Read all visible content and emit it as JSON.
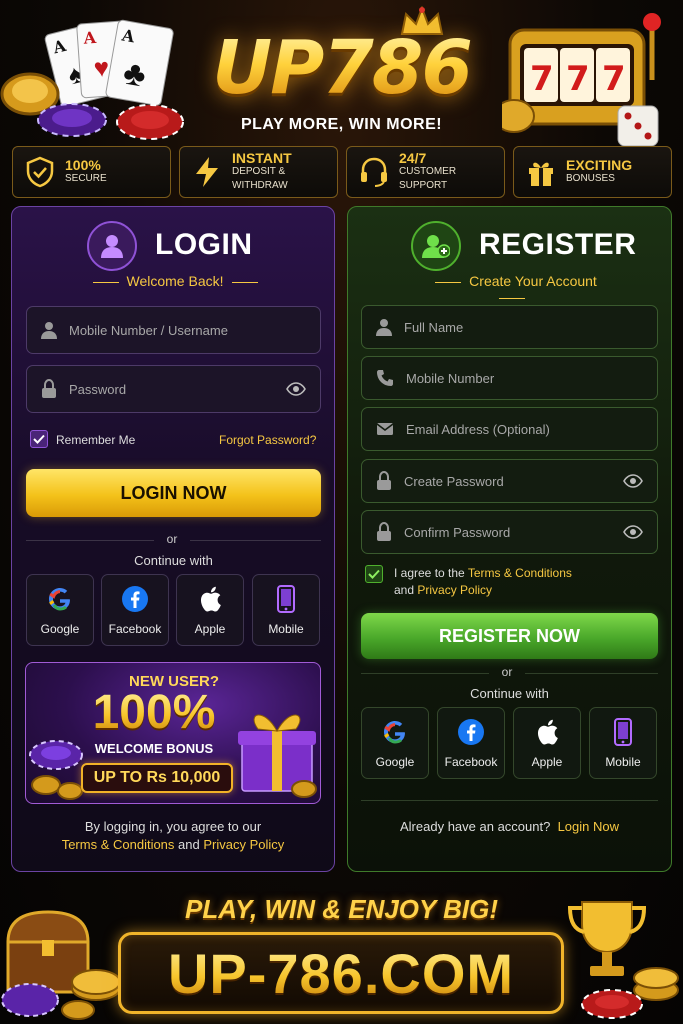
{
  "brand": {
    "logo": "UP786",
    "tagline": "PLAY MORE, WIN MORE!",
    "gold": "#f6c842"
  },
  "features": [
    {
      "icon": "shield-check-icon",
      "title": "100%",
      "subtitle": "SECURE"
    },
    {
      "icon": "lightning-icon",
      "title": "INSTANT",
      "subtitle": "DEPOSIT & WITHDRAW"
    },
    {
      "icon": "headset-icon",
      "title": "24/7",
      "subtitle": "CUSTOMER SUPPORT"
    },
    {
      "icon": "gift-icon",
      "title": "EXCITING",
      "subtitle": "BONUSES"
    }
  ],
  "login": {
    "title": "LOGIN",
    "subtitle": "Welcome Back!",
    "username_placeholder": "Mobile Number / Username",
    "password_placeholder": "Password",
    "remember_label": "Remember Me",
    "remember_checked": true,
    "forgot_label": "Forgot Password?",
    "submit_label": "LOGIN NOW",
    "or_label": "or",
    "continue_label": "Continue with",
    "social": [
      "Google",
      "Facebook",
      "Apple",
      "Mobile"
    ],
    "accent": "#8f52d6"
  },
  "bonus": {
    "line1": "NEW USER?",
    "amount": "100%",
    "line2": "WELCOME BONUS",
    "cap": "UP TO Rs 10,000"
  },
  "login_terms": {
    "prefix": "By logging in, you agree to our",
    "terms": "Terms & Conditions",
    "and": "and",
    "privacy": "Privacy Policy"
  },
  "register": {
    "title": "REGISTER",
    "subtitle": "Create Your Account",
    "fields": [
      {
        "icon": "user-icon",
        "placeholder": "Full Name"
      },
      {
        "icon": "phone-icon",
        "placeholder": "Mobile Number"
      },
      {
        "icon": "mail-icon",
        "placeholder": "Email Address (Optional)"
      },
      {
        "icon": "lock-icon",
        "placeholder": "Create Password"
      },
      {
        "icon": "lock-icon",
        "placeholder": "Confirm Password"
      }
    ],
    "agree_prefix": "I agree to the",
    "agree_terms": "Terms & Conditions",
    "agree_and": "and",
    "agree_privacy": "Privacy Policy",
    "agree_checked": true,
    "submit_label": "REGISTER NOW",
    "or_label": "or",
    "continue_label": "Continue with",
    "social": [
      "Google",
      "Facebook",
      "Apple",
      "Mobile"
    ],
    "have_account": "Already have an account?",
    "login_link": "Login Now",
    "accent": "#4fb02d"
  },
  "footer": {
    "slogan": "PLAY, WIN & ENJOY BIG!",
    "domain": "UP-786.COM"
  }
}
